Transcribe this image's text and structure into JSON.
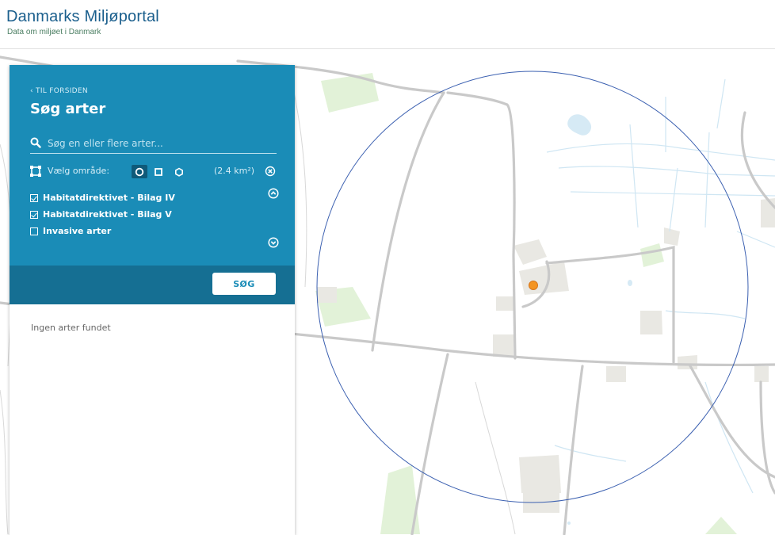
{
  "header": {
    "title": "Danmarks Miljøportal",
    "subtitle": "Data om miljøet i Danmark"
  },
  "panel": {
    "back_link": "‹ TIL FORSIDEN",
    "title": "Søg arter",
    "search": {
      "placeholder": "Søg en eller flere arter...",
      "value": ""
    },
    "area": {
      "label": "Vælg område:",
      "shapes": [
        {
          "name": "circle",
          "active": true
        },
        {
          "name": "square",
          "active": false
        },
        {
          "name": "polygon",
          "active": false
        }
      ],
      "size": "(2.4 km²)"
    },
    "filters": [
      {
        "label": "Habitatdirektivet - Bilag IV",
        "checked": true
      },
      {
        "label": "Habitatdirektivet - Bilag V",
        "checked": true
      },
      {
        "label": "Invasive arter",
        "checked": false
      }
    ],
    "search_button": "SØG",
    "results_empty": "Ingen arter fundet"
  },
  "icons": {
    "search": "search-icon",
    "area": "area-select-icon",
    "clear": "close-circle-icon",
    "collapse": "chevron-up-circle-icon",
    "expand": "chevron-down-circle-icon",
    "marker": "location-marker"
  },
  "colors": {
    "panel_blue": "#1a8cb7",
    "panel_footer": "#156f93",
    "brand": "#1b5f8d",
    "search_circle": "#3a5fb0",
    "marker": "#f39422"
  }
}
